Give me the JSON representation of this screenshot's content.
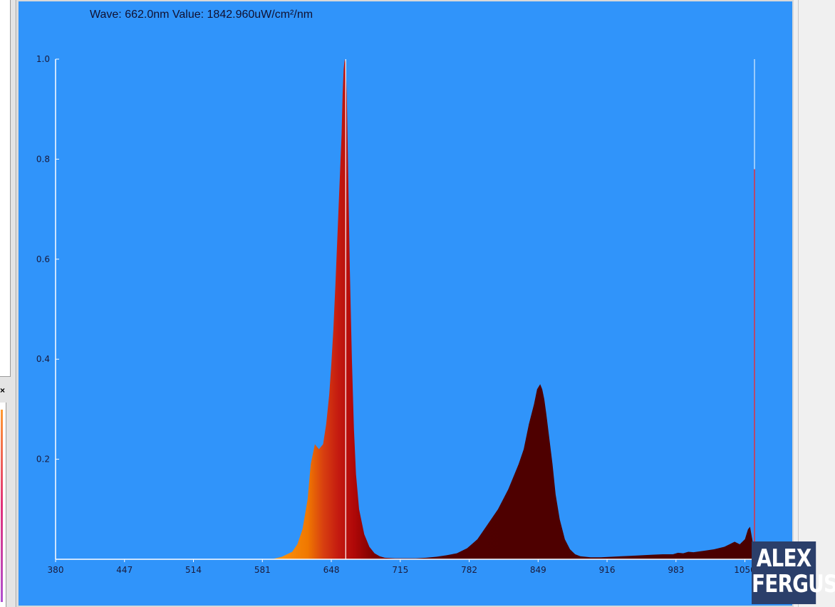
{
  "readout": "Wave: 662.0nm Value: 1842.960uW/cm²/nm",
  "logo": {
    "line1": "ALEX",
    "line2": "FERGUS"
  },
  "left_panel": {
    "close_glyph": "×"
  },
  "colors": {
    "plot_bg": "#3094fa",
    "axis": "#ffffff",
    "cursor": "#ffffff",
    "marker": "#e03040"
  },
  "chart_data": {
    "type": "area",
    "title": "",
    "xlabel": "",
    "ylabel": "",
    "xlim": [
      380,
      1060
    ],
    "ylim": [
      0,
      1.0
    ],
    "x_ticks": [
      380,
      447,
      514,
      581,
      648,
      715,
      782,
      849,
      916,
      983,
      1050
    ],
    "x_tick_labels": [
      "380",
      "447",
      "514",
      "581",
      "648",
      "715",
      "782",
      "849",
      "916",
      "983",
      "1050"
    ],
    "y_ticks": [
      0.2,
      0.4,
      0.6,
      0.8,
      1.0
    ],
    "y_tick_labels": [
      "0.2",
      "0.4",
      "0.6",
      "0.8",
      "1.0"
    ],
    "cursor_wavelength": 662.0,
    "marker_wavelength": 1060,
    "marker_value": 0.78,
    "fill": "wavelength-color gradient",
    "series": [
      {
        "x": [
          590,
          600,
          610,
          615,
          620,
          625,
          628,
          632,
          636,
          640,
          643,
          646,
          648,
          650,
          652,
          654,
          656,
          658,
          659,
          660,
          661,
          662,
          663,
          664,
          665,
          666,
          668,
          670,
          672,
          675,
          680,
          685,
          690,
          695,
          700,
          710,
          720,
          730,
          740,
          750,
          760,
          770,
          780,
          790,
          800,
          810,
          820,
          830,
          835,
          840,
          845,
          848,
          851,
          853,
          855,
          857,
          860,
          863,
          866,
          870,
          875,
          880,
          885,
          890,
          900,
          910,
          920,
          930,
          940,
          950,
          960,
          970,
          980,
          985,
          990,
          995,
          1000,
          1010,
          1020,
          1030,
          1035,
          1040,
          1045,
          1050,
          1053,
          1055,
          1058
        ],
        "y": [
          0.0,
          0.005,
          0.015,
          0.03,
          0.06,
          0.12,
          0.19,
          0.23,
          0.22,
          0.23,
          0.27,
          0.33,
          0.39,
          0.46,
          0.55,
          0.65,
          0.75,
          0.85,
          0.93,
          0.98,
          1.0,
          0.99,
          0.93,
          0.82,
          0.7,
          0.58,
          0.4,
          0.26,
          0.17,
          0.1,
          0.05,
          0.025,
          0.012,
          0.006,
          0.003,
          0.002,
          0.002,
          0.002,
          0.003,
          0.005,
          0.008,
          0.012,
          0.022,
          0.04,
          0.07,
          0.1,
          0.14,
          0.19,
          0.22,
          0.27,
          0.31,
          0.34,
          0.35,
          0.34,
          0.32,
          0.29,
          0.24,
          0.19,
          0.13,
          0.08,
          0.04,
          0.02,
          0.01,
          0.006,
          0.004,
          0.004,
          0.005,
          0.006,
          0.007,
          0.008,
          0.009,
          0.01,
          0.01,
          0.013,
          0.012,
          0.015,
          0.014,
          0.017,
          0.02,
          0.025,
          0.03,
          0.035,
          0.03,
          0.04,
          0.06,
          0.065,
          0.03
        ]
      }
    ]
  }
}
